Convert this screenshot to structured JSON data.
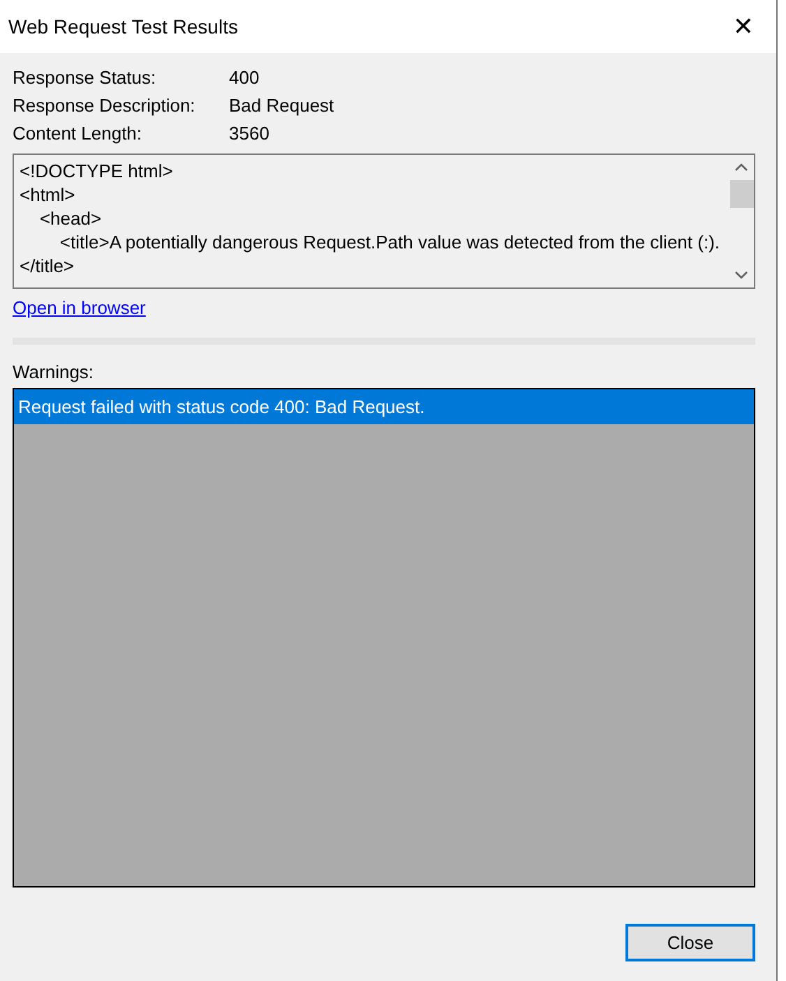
{
  "window": {
    "title": "Web Request Test Results",
    "close_glyph": "✕"
  },
  "fields": [
    {
      "label": "Response Status:",
      "value": "400"
    },
    {
      "label": "Response Description:",
      "value": "Bad Request"
    },
    {
      "label": "Content Length:",
      "value": "3560"
    }
  ],
  "response_body": {
    "lines": [
      "<!DOCTYPE html>",
      "<html>",
      "    <head>",
      "        <title>A potentially dangerous Request.Path value was detected from the client (:).</title>"
    ]
  },
  "link": "Open in browser",
  "warnings": {
    "label": "Warnings:",
    "items": [
      {
        "text": "Request failed with status code 400: Bad Request.",
        "selected": true
      }
    ]
  },
  "buttons": [
    {
      "label": "Close",
      "focused": true
    }
  ]
}
